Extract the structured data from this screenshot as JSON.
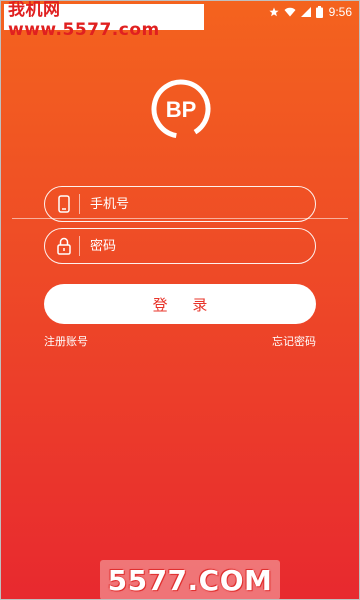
{
  "status_bar": {
    "time": "9:56",
    "icons": [
      "star-icon",
      "wifi-icon",
      "signal-icon",
      "battery-icon"
    ]
  },
  "watermark_top": {
    "text": "我机网 www.5577.com"
  },
  "logo": {
    "text": "BP"
  },
  "login_form": {
    "phone_placeholder": "手机号",
    "password_placeholder": "密码",
    "login_button_label": "登 录",
    "register_link": "注册账号",
    "forgot_link": "忘记密码"
  },
  "watermark_bottom": {
    "text": "5577.COM"
  },
  "colors": {
    "gradient_top": "#f4631e",
    "gradient_bottom": "#e8292f",
    "button_text": "#e8342a"
  }
}
